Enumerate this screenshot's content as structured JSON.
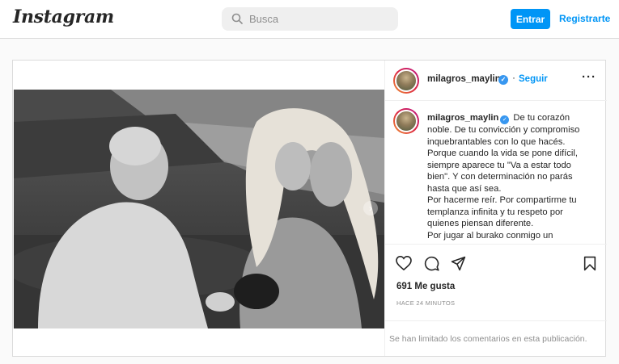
{
  "header": {
    "logo": "Instagram",
    "search_placeholder": "Busca",
    "login_label": "Entrar",
    "signup_label": "Registrarte"
  },
  "post": {
    "username": "milagros_maylin",
    "follow_label": "Seguir",
    "caption_lines": [
      "De tu corazón",
      "noble. De tu convicción y compromiso",
      "inquebrantables con lo que hacés.",
      "Porque cuando la vida se pone difícil,",
      "siempre aparece tu \"Va a estar todo",
      "bien\". Y con determinación no parás",
      "hasta que así sea.",
      "Por hacerme reír. Por compartirme tu",
      "templanza infinita y tu respeto por",
      "quienes piensan diferente.",
      "Por jugar al burako conmigo un"
    ],
    "likes": "691 Me gusta",
    "time_ago": "HACE 24 MINUTOS",
    "comments_notice": "Se han limitado los comentarios en esta publicación."
  },
  "icons": [
    "search-icon",
    "verified-icon",
    "more-icon",
    "heart-icon",
    "comment-icon",
    "share-icon",
    "bookmark-icon",
    "next-arrow-icon"
  ],
  "colors": {
    "accent": "#0095f6",
    "verified": "#3897f0",
    "border": "#dbdbdb"
  }
}
